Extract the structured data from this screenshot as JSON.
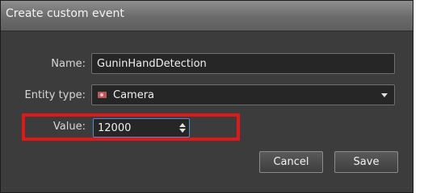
{
  "window": {
    "title": "Create custom event"
  },
  "form": {
    "name_label": "Name:",
    "name_value": "GuninHandDetection",
    "entity_type_label": "Entity type:",
    "entity_type_icon": "camera-icon",
    "entity_type_value": "Camera",
    "value_label": "Value:",
    "value_value": "12000"
  },
  "buttons": {
    "cancel_label": "Cancel",
    "save_label": "Save"
  },
  "colors": {
    "highlight": "#e01818",
    "focus_border": "#4a8fd8",
    "dialog_background": "#3c3c3c"
  }
}
